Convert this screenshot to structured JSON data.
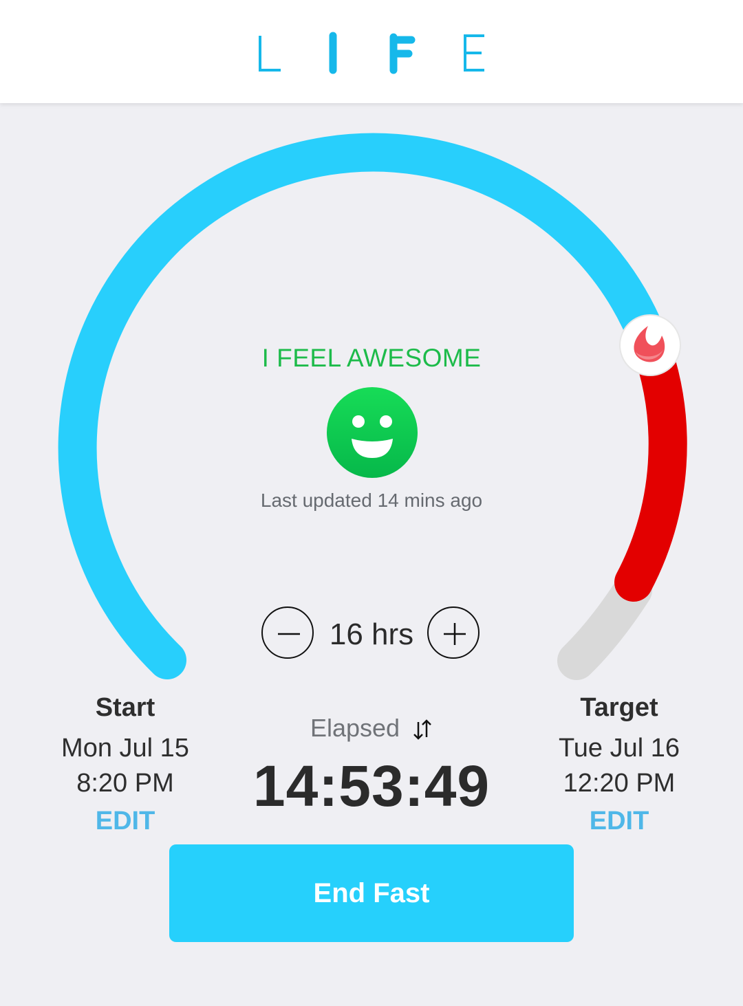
{
  "header": {
    "logo_letters": [
      "L",
      "I",
      "F",
      "E"
    ],
    "accent_color": "#16b8ea"
  },
  "gauge": {
    "progress_color": "#28cffc",
    "overtime_color": "#e30000",
    "remaining_color": "#d9d9d9",
    "marker_icon": "flame-drop-icon"
  },
  "mood": {
    "text": "I FEEL AWESOME",
    "face_icon": "smiley-face-icon",
    "updated": "Last updated 14 mins ago"
  },
  "duration": {
    "value": "16 hrs",
    "minus_icon": "minus-icon",
    "plus_icon": "plus-icon"
  },
  "start": {
    "label": "Start",
    "date": "Mon Jul 15",
    "time": "8:20 PM",
    "edit": "EDIT"
  },
  "target": {
    "label": "Target",
    "date": "Tue Jul 16",
    "time": "12:20 PM",
    "edit": "EDIT"
  },
  "elapsed": {
    "label": "Elapsed",
    "swap_icon": "swap-vertical-icon",
    "value": "14:53:49"
  },
  "action": {
    "end_label": "End Fast"
  }
}
